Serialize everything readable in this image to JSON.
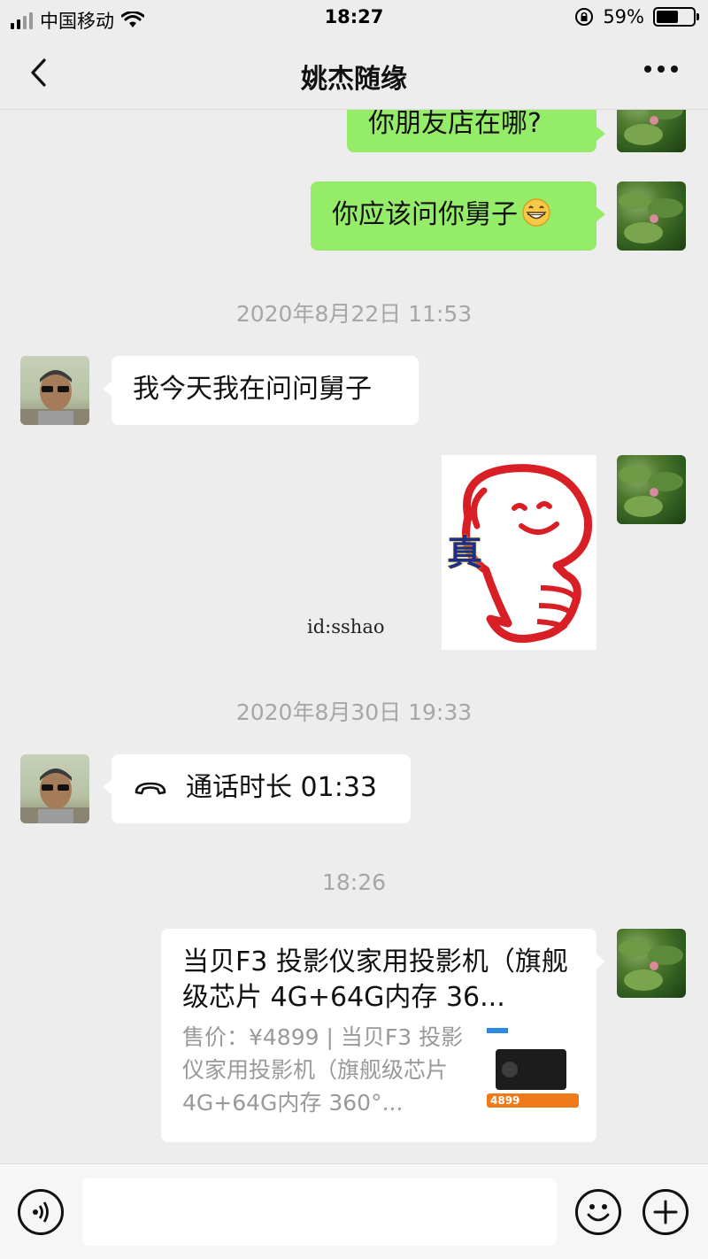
{
  "status_bar": {
    "carrier": "中国移动",
    "time": "18:27",
    "battery_percent_label": "59%",
    "battery_level": 0.59,
    "icons": [
      "signal-bars-icon",
      "wifi-icon",
      "orientation-lock-icon",
      "battery-icon"
    ]
  },
  "header": {
    "title": "姚杰随缘",
    "icons": [
      "back-chevron-icon",
      "more-options-icon"
    ]
  },
  "messages": {
    "m1": {
      "sender": "me",
      "text": "你朋友店在哪?"
    },
    "m2": {
      "sender": "me",
      "text": "你应该问你舅子",
      "emoji": "grin-emoji-icon"
    },
    "t1": "2020年8月22日 11:53",
    "m3": {
      "sender": "contact",
      "text": "我今天我在问问舅子"
    },
    "m4": {
      "sender": "me",
      "type": "sticker",
      "sticker_text": "真",
      "caption": "id:sshao"
    },
    "t2": "2020年8月30日 19:33",
    "m5": {
      "sender": "contact",
      "type": "call",
      "text": "通话时长 01:33",
      "icon": "phone-hangup-icon"
    },
    "t3": "18:26",
    "m6": {
      "sender": "me",
      "type": "link",
      "title": "当贝F3 投影仪家用投影机（旗舰级芯片 4G+64G内存 36...",
      "description": "售价：¥4899 | 当贝F3 投影仪家用投影机（旗舰级芯片 4G+64G内存 360°...",
      "thumb_price": "4899"
    }
  },
  "input_bar": {
    "placeholder": "",
    "icons": [
      "voice-input-icon",
      "emoji-face-icon",
      "plus-more-icon"
    ]
  },
  "colors": {
    "background": "#ededed",
    "my_bubble": "#95ec69",
    "their_bubble": "#ffffff",
    "timestamp_text": "#a6a6a6"
  }
}
